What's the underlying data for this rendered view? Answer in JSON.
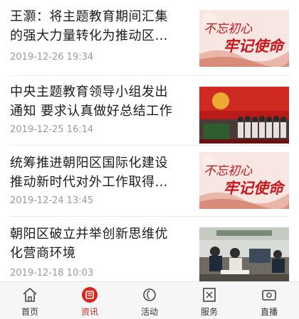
{
  "news": [
    {
      "title_line1": "王灏：将主题教育期间汇集",
      "title_line2": "的强大力量转化为推动区…",
      "time": "2019-12-26 19:34",
      "thumb": "slogan-banner"
    },
    {
      "title_line1": "中央主题教育领导小组发出",
      "title_line2": "通知 要求认真做好总结工作",
      "time": "2019-12-25 16:14",
      "thumb": "party-meeting-photo"
    },
    {
      "title_line1": "统筹推进朝阳区国际化建设",
      "title_line2": "推动新时代对外工作取得…",
      "time": "2019-12-24 13:45",
      "thumb": "slogan-banner"
    },
    {
      "title_line1": "朝阳区破立并举创新思维优",
      "title_line2": "化营商环境",
      "time": "2019-12-18 10:03",
      "thumb": "service-hall-photo"
    }
  ],
  "banner_text": {
    "line1": "不忘初心",
    "line2": "牢记使命"
  },
  "tabs": [
    {
      "label": "首页",
      "icon": "home-icon",
      "active": false
    },
    {
      "label": "资讯",
      "icon": "news-icon",
      "active": true
    },
    {
      "label": "活动",
      "icon": "activity-icon",
      "active": false
    },
    {
      "label": "服务",
      "icon": "service-icon",
      "active": false
    },
    {
      "label": "直播",
      "icon": "live-icon",
      "active": false
    }
  ],
  "colors": {
    "accent": "#d9261c",
    "banner_red": "#c8151b",
    "time_gray": "#9a9a9a"
  }
}
